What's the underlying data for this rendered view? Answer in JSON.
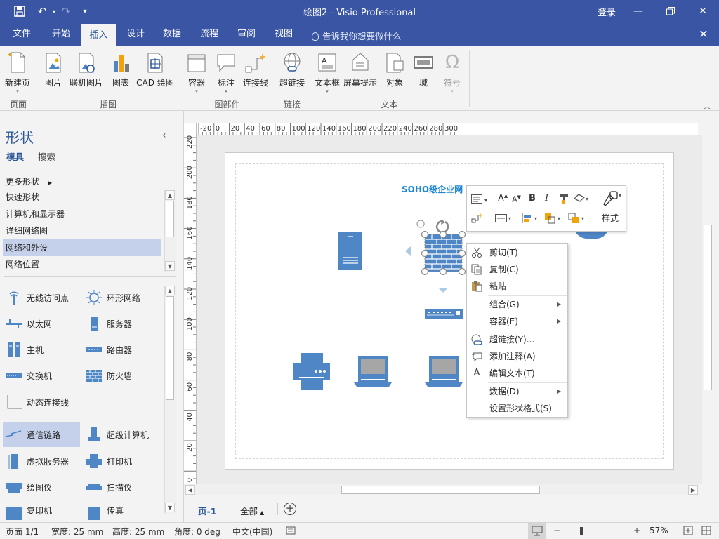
{
  "app": {
    "title": "绘图2 - Visio Professional",
    "login": "登录",
    "qat_undo": "↶",
    "qat_redo": "↷",
    "qat_customize": "▾"
  },
  "tabs": [
    {
      "label": "文件"
    },
    {
      "label": "开始"
    },
    {
      "label": "插入",
      "active": true
    },
    {
      "label": "设计"
    },
    {
      "label": "数据"
    },
    {
      "label": "流程"
    },
    {
      "label": "审阅"
    },
    {
      "label": "视图"
    }
  ],
  "tellme": "告诉我你想要做什么",
  "ribbon": {
    "buttons": {
      "new_page": "新建页",
      "picture": "图片",
      "online_picture": "联机图片",
      "chart": "图表",
      "cad": "CAD 绘图",
      "container": "容器",
      "callout": "标注",
      "connector": "连接线",
      "hyperlink": "超链接",
      "textbox": "文本框",
      "screentip": "屏幕提示",
      "object": "对象",
      "field": "域",
      "symbol": "符号"
    },
    "groups": {
      "pages": "页面",
      "illustrations": "插图",
      "diagram_parts": "图部件",
      "links": "链接",
      "text": "文本"
    }
  },
  "shapes_pane": {
    "title": "形状",
    "tab_stencils": "模具",
    "tab_search": "搜索",
    "more_shapes": "更多形状",
    "stencils": [
      "快速形状",
      "计算机和显示器",
      "详细网络图",
      "网络和外设",
      "网络位置"
    ],
    "selected_stencil": "网络和外设",
    "masters": [
      "无线访问点",
      "环形网络",
      "以太网",
      "服务器",
      "主机",
      "路由器",
      "交换机",
      "防火墙",
      "动态连接线",
      "通信链路",
      "超级计算机",
      "虚拟服务器",
      "打印机",
      "绘图仪",
      "扫描仪",
      "复印机",
      "传真"
    ],
    "selected_master": "通信链路"
  },
  "ruler": {
    "top": [
      "-20",
      "0",
      "20",
      "40",
      "60",
      "80",
      "100",
      "120",
      "140",
      "160",
      "180",
      "200",
      "220",
      "240",
      "260",
      "280",
      "300"
    ],
    "left": [
      "220",
      "200",
      "180",
      "160",
      "140",
      "120",
      "100",
      "80",
      "60",
      "40",
      "20",
      "0"
    ]
  },
  "drawing": {
    "title": "SOHO级企业网"
  },
  "mini_toolbar": {
    "bold": "B",
    "italic": "I",
    "style": "样式"
  },
  "context_menu": [
    {
      "label": "剪切(T)",
      "icon": "scissors-icon"
    },
    {
      "label": "复制(C)",
      "icon": "copy-icon"
    },
    {
      "label": "粘贴",
      "icon": "paste-icon"
    },
    {
      "label": "组合(G)",
      "submenu": true
    },
    {
      "label": "容器(E)",
      "submenu": true
    },
    {
      "label": "超链接(Y)...",
      "icon": "hyperlink-icon"
    },
    {
      "label": "添加注释(A)",
      "icon": "comment-icon"
    },
    {
      "label": "编辑文本(T)",
      "icon": "edit-text-icon"
    },
    {
      "label": "数据(D)",
      "submenu": true
    },
    {
      "label": "设置形状格式(S)"
    }
  ],
  "page_tabs": {
    "current": "页-1",
    "all": "全部"
  },
  "status": {
    "page": "页面 1/1",
    "width": "宽度: 25 mm",
    "height": "高度: 25 mm",
    "angle": "角度: 0 deg",
    "language": "中文(中国)",
    "zoom": "57%"
  },
  "colors": {
    "titlebar": "#3955a3",
    "accent": "#2b579a",
    "shape_blue": "#4f86c6",
    "selection": "#c5d0ea"
  }
}
